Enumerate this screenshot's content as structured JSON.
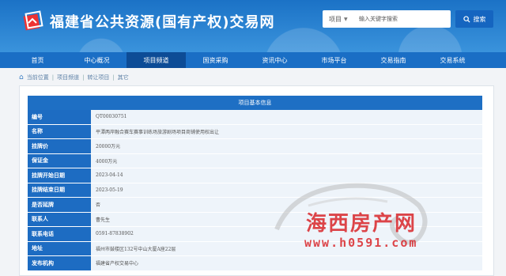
{
  "header": {
    "title": "福建省公共资源(国有产权)交易网",
    "search_type": "项目",
    "search_placeholder": "输入关键字搜索",
    "search_button": "搜索"
  },
  "nav": {
    "items": [
      "首页",
      "中心概况",
      "项目频道",
      "国资采购",
      "资讯中心",
      "市场平台",
      "交易指南",
      "交易系统"
    ],
    "active_index": 2
  },
  "breadcrumb": [
    "当前位置",
    "项目频道",
    "转让项目",
    "其它"
  ],
  "table": {
    "title": "项目基本信息",
    "rows": [
      {
        "label": "编号",
        "value": "QT00030751"
      },
      {
        "label": "名称",
        "value": "平潭两岸融合赛车赛事训练场旅游剧场项目商铺使用权出让"
      },
      {
        "label": "挂牌价",
        "value": "20000万元"
      },
      {
        "label": "保证金",
        "value": "4000万元"
      },
      {
        "label": "挂牌开始日期",
        "value": "2023-04-14"
      },
      {
        "label": "挂牌结束日期",
        "value": "2023-05-19"
      },
      {
        "label": "是否延牌",
        "value": "否"
      },
      {
        "label": "联系人",
        "value": "曹先生"
      },
      {
        "label": "联系电话",
        "value": "0591-87838902"
      },
      {
        "label": "地址",
        "value": "福州市鼓楼区132号中山大厦A座22层"
      },
      {
        "label": "发布机构",
        "value": "福建省产权交易中心"
      }
    ]
  },
  "watermark": {
    "text": "海西房产网",
    "url": "www.h0591.com"
  },
  "colors": {
    "header_blue": "#1b72c6",
    "nav_active": "#0d4c96",
    "label_blue": "#1d6cc2",
    "watermark_red": "#d9262a"
  }
}
